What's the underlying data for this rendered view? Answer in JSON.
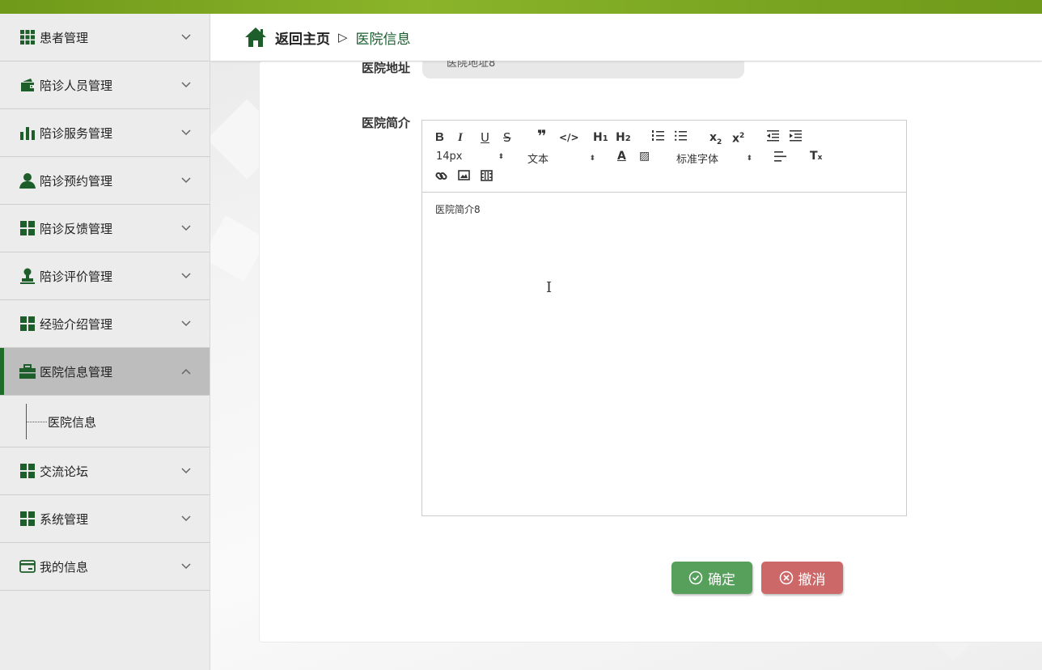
{
  "sidebar": {
    "items": [
      {
        "label": "患者管理",
        "icon": "grid-icon"
      },
      {
        "label": "陪诊人员管理",
        "icon": "wallet-icon"
      },
      {
        "label": "陪诊服务管理",
        "icon": "bar-chart-icon"
      },
      {
        "label": "陪诊预约管理",
        "icon": "user-icon"
      },
      {
        "label": "陪诊反馈管理",
        "icon": "apps-icon"
      },
      {
        "label": "陪诊评价管理",
        "icon": "stamp-icon"
      },
      {
        "label": "经验介绍管理",
        "icon": "apps-icon"
      },
      {
        "label": "医院信息管理",
        "icon": "briefcase-icon"
      },
      {
        "label": "交流论坛",
        "icon": "apps-icon"
      },
      {
        "label": "系统管理",
        "icon": "apps-icon"
      },
      {
        "label": "我的信息",
        "icon": "card-icon"
      }
    ],
    "sub_item": "医院信息"
  },
  "breadcrumb": {
    "home": "返回主页",
    "separator": "▷",
    "current": "医院信息"
  },
  "form": {
    "address_label": "医院地址",
    "address_value": "医院地址8",
    "intro_label": "医院简介",
    "intro_content": "医院简介8"
  },
  "editor": {
    "font_size": "14px",
    "header_select": "文本",
    "font_family": "标准字体"
  },
  "buttons": {
    "confirm": "确定",
    "cancel": "撤消"
  },
  "colors": {
    "brand_green": "#1e6b2a",
    "confirm": "#56a05b",
    "cancel": "#cd6868"
  }
}
